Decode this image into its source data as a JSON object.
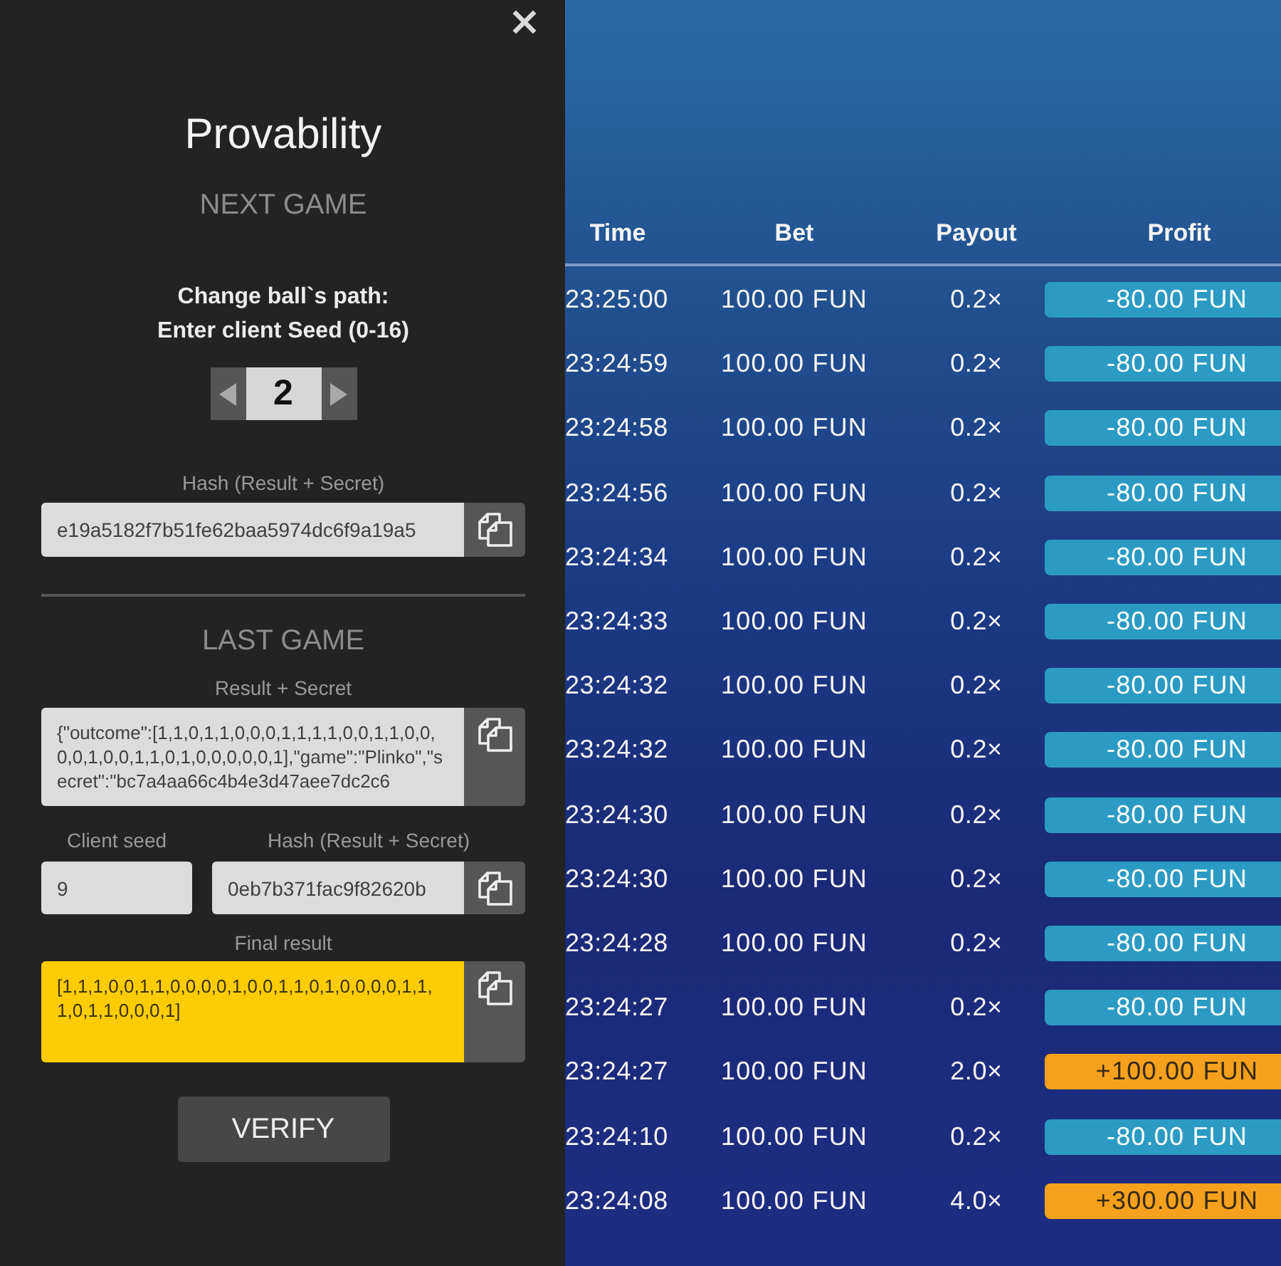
{
  "panel": {
    "title": "Provability",
    "next_game": {
      "heading": "NEXT GAME",
      "instructions": [
        "Change ball`s path:",
        "Enter client Seed (0-16)"
      ],
      "seed": {
        "value": "2"
      },
      "hash": {
        "label": "Hash (Result + Secret)",
        "value": "e19a5182f7b51fe62baa5974dc6f9a19a5"
      }
    },
    "last_game": {
      "heading": "LAST GAME",
      "result_secret": {
        "label": "Result + Secret",
        "value": "{\"outcome\":[1,1,0,1,1,0,0,0,1,1,1,1,0,0,1,1,0,0,0,0,1,0,0,1,1,0,1,0,0,0,0,0,1],\"game\":\"Plinko\",\"secret\":\"bc7a4aa66c4b4e3d47aee7dc2c6"
      },
      "client_seed": {
        "label": "Client seed",
        "value": "9"
      },
      "hash": {
        "label": "Hash (Result + Secret)",
        "value": "0eb7b371fac9f82620b"
      },
      "final_result": {
        "label": "Final result",
        "value": "[1,1,1,0,0,1,1,0,0,0,0,1,0,0,1,1,0,1,0,0,0,0,1,1,1,0,1,1,0,0,0,1]"
      }
    },
    "verify_button": "VERIFY"
  },
  "bets_table": {
    "columns": [
      "Time",
      "Bet",
      "Payout",
      "Profit"
    ],
    "rows": [
      {
        "time": "23:25:00",
        "bet": "100.00 FUN",
        "payout": "0.2×",
        "profit": "-80.00 FUN",
        "color": "#2b9bc3"
      },
      {
        "time": "23:24:59",
        "bet": "100.00 FUN",
        "payout": "0.2×",
        "profit": "-80.00 FUN",
        "color": "#2b9bc3"
      },
      {
        "time": "23:24:58",
        "bet": "100.00 FUN",
        "payout": "0.2×",
        "profit": "-80.00 FUN",
        "color": "#2b9bc3"
      },
      {
        "time": "23:24:56",
        "bet": "100.00 FUN",
        "payout": "0.2×",
        "profit": "-80.00 FUN",
        "color": "#2b9bc3"
      },
      {
        "time": "23:24:34",
        "bet": "100.00 FUN",
        "payout": "0.2×",
        "profit": "-80.00 FUN",
        "color": "#2b9bc3"
      },
      {
        "time": "23:24:33",
        "bet": "100.00 FUN",
        "payout": "0.2×",
        "profit": "-80.00 FUN",
        "color": "#2b9bc3"
      },
      {
        "time": "23:24:32",
        "bet": "100.00 FUN",
        "payout": "0.2×",
        "profit": "-80.00 FUN",
        "color": "#2b9bc3"
      },
      {
        "time": "23:24:32",
        "bet": "100.00 FUN",
        "payout": "0.2×",
        "profit": "-80.00 FUN",
        "color": "#2b9bc3"
      },
      {
        "time": "23:24:30",
        "bet": "100.00 FUN",
        "payout": "0.2×",
        "profit": "-80.00 FUN",
        "color": "#2b9bc3"
      },
      {
        "time": "23:24:30",
        "bet": "100.00 FUN",
        "payout": "0.2×",
        "profit": "-80.00 FUN",
        "color": "#2b9bc3"
      },
      {
        "time": "23:24:28",
        "bet": "100.00 FUN",
        "payout": "0.2×",
        "profit": "-80.00 FUN",
        "color": "#2b9bc3"
      },
      {
        "time": "23:24:27",
        "bet": "100.00 FUN",
        "payout": "0.2×",
        "profit": "-80.00 FUN",
        "color": "#2b9bc3"
      },
      {
        "time": "23:24:27",
        "bet": "100.00 FUN",
        "payout": "2.0×",
        "profit": "+100.00 FUN",
        "color": "#f6a11d"
      },
      {
        "time": "23:24:10",
        "bet": "100.00 FUN",
        "payout": "0.2×",
        "profit": "-80.00 FUN",
        "color": "#2b9bc3"
      },
      {
        "time": "23:24:08",
        "bet": "100.00 FUN",
        "payout": "4.0×",
        "profit": "+300.00 FUN",
        "color": "#f6a11d"
      }
    ]
  }
}
